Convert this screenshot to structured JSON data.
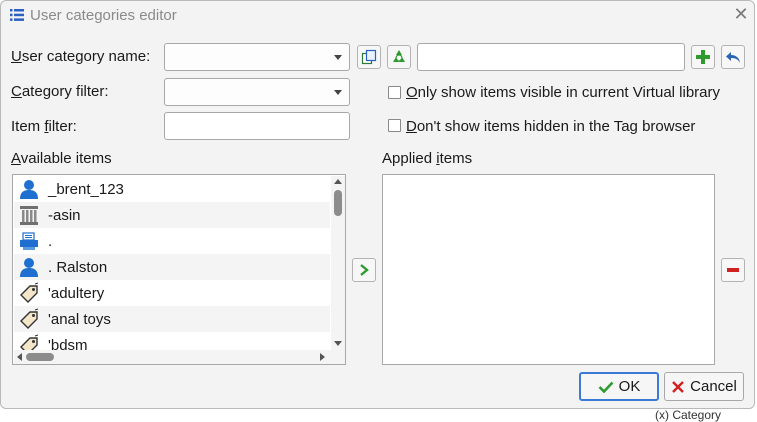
{
  "window": {
    "title": "User categories editor"
  },
  "labels": {
    "user_category_name_pre": "",
    "user_category_name_u": "U",
    "user_category_name_post": "ser category name:",
    "category_filter_pre": "",
    "category_filter_u": "C",
    "category_filter_post": "ategory filter:",
    "item_filter_pre": "Item ",
    "item_filter_u": "f",
    "item_filter_post": "ilter:",
    "available_pre": "",
    "available_u": "A",
    "available_post": "vailable items",
    "applied_pre": "Applied ",
    "applied_u": "i",
    "applied_post": "tems"
  },
  "fields": {
    "user_category_name": "",
    "category_filter": "",
    "item_filter": "",
    "new_category_name": ""
  },
  "checkboxes": {
    "only_visible_u": "O",
    "only_visible_rest": "nly show items visible in current Virtual library",
    "only_visible_checked": false,
    "dont_show_u": "D",
    "dont_show_rest": "on't show items hidden in the Tag browser",
    "dont_show_checked": false
  },
  "available_items": [
    {
      "label": "_brent_123",
      "icon": "author-icon"
    },
    {
      "label": "-asin",
      "icon": "identifier-icon"
    },
    {
      "label": ".",
      "icon": "publisher-icon"
    },
    {
      "label": ". Ralston",
      "icon": "author-icon"
    },
    {
      "label": "'adultery",
      "icon": "tag-icon"
    },
    {
      "label": "'anal toys",
      "icon": "tag-icon"
    },
    {
      "label": "'bdsm",
      "icon": "tag-icon"
    }
  ],
  "applied_items": [],
  "buttons": {
    "ok": "OK",
    "cancel": "Cancel"
  },
  "background_peek": "(x) Category",
  "colors": {
    "accent": "#3a7bd5",
    "green": "#2e9b2e",
    "red": "#d02020",
    "person_blue": "#1f6fd1"
  }
}
